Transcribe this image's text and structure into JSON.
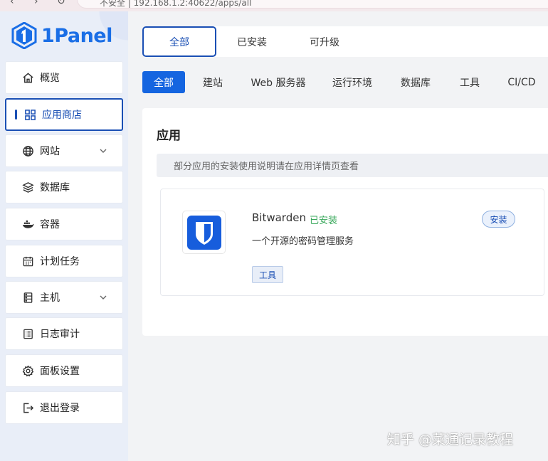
{
  "browser": {
    "url_fragment": "不安全 | 192.168.1.2:40622/apps/all"
  },
  "brand": {
    "name": "1Panel",
    "color": "#1a6ee6"
  },
  "sidebar": {
    "items": [
      {
        "label": "概览",
        "icon": "home-icon"
      },
      {
        "label": "应用商店",
        "icon": "grid-icon",
        "active": true
      },
      {
        "label": "网站",
        "icon": "globe-icon",
        "expandable": true
      },
      {
        "label": "数据库",
        "icon": "layers-icon"
      },
      {
        "label": "容器",
        "icon": "docker-icon"
      },
      {
        "label": "计划任务",
        "icon": "calendar-icon"
      },
      {
        "label": "主机",
        "icon": "server-icon",
        "expandable": true
      },
      {
        "label": "日志审计",
        "icon": "log-icon"
      },
      {
        "label": "面板设置",
        "icon": "gear-icon"
      },
      {
        "label": "退出登录",
        "icon": "logout-icon"
      }
    ]
  },
  "top_tabs": [
    {
      "label": "全部",
      "active": true
    },
    {
      "label": "已安装"
    },
    {
      "label": "可升级"
    }
  ],
  "category_tabs": [
    {
      "label": "全部",
      "active": true
    },
    {
      "label": "建站"
    },
    {
      "label": "Web 服务器"
    },
    {
      "label": "运行环境"
    },
    {
      "label": "数据库"
    },
    {
      "label": "工具"
    },
    {
      "label": "CI/CD"
    }
  ],
  "main": {
    "section_title": "应用",
    "notice": "部分应用的安装使用说明请在应用详情页查看",
    "apps": [
      {
        "name": "Bitwarden",
        "status": "已安装",
        "description": "一个开源的密码管理服务",
        "tag": "工具",
        "action": "安装",
        "icon": "bitwarden-shield-icon",
        "icon_color": "#175ddc"
      }
    ]
  },
  "watermark": "知乎 @菜通记录教程",
  "colors": {
    "accent": "#1565e0",
    "active_border": "#1a4fb4",
    "installed_green": "#39a85b"
  }
}
